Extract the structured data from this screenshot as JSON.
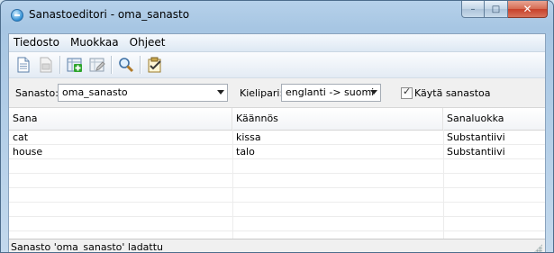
{
  "window": {
    "title": "Sanastoeditori - oma_sanasto",
    "buttons": {
      "minimize": "–",
      "maximize": "□",
      "close": "✕"
    }
  },
  "menu": {
    "items": [
      "Tiedosto",
      "Muokkaa",
      "Ohjeet"
    ]
  },
  "toolbar": {
    "icons": [
      "new-document-icon",
      "open-icon-disabled",
      "add-word-icon",
      "edit-word-icon",
      "search-icon",
      "check-icon"
    ]
  },
  "filter": {
    "sanasto_label": "Sanasto:",
    "sanasto_value": "oma_sanasto",
    "kielipari_label": "Kielipari:",
    "kielipari_value": "englanti -> suomi",
    "use_checkbox_label": "Käytä sanastoa",
    "use_checkbox_checked": true
  },
  "table": {
    "columns": [
      "Sana",
      "Käännös",
      "Sanaluokka"
    ],
    "rows": [
      [
        "cat",
        "kissa",
        "Substantiivi"
      ],
      [
        "house",
        "talo",
        "Substantiivi"
      ]
    ]
  },
  "status": {
    "text": "Sanasto 'oma_sanasto' ladattu"
  },
  "colors": {
    "title_bg": "#b6d1ea",
    "close_button": "#c7412a",
    "window_bg": "#f0f0f0"
  }
}
